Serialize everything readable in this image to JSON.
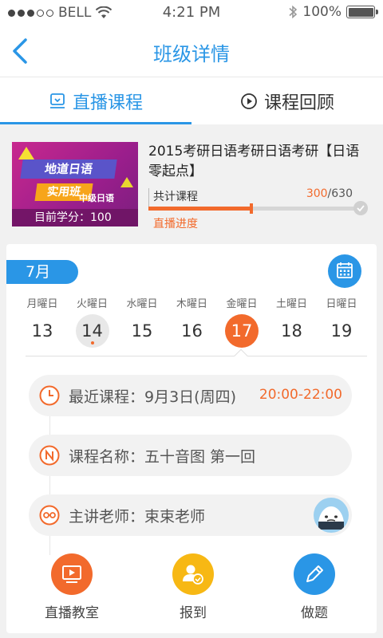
{
  "status_bar": {
    "carrier": "BELL",
    "time": "4:21 PM",
    "battery": "100%"
  },
  "nav": {
    "title": "班级详情"
  },
  "tabs": [
    {
      "label": "直播课程",
      "active": true,
      "icon": "live-course-icon"
    },
    {
      "label": "课程回顾",
      "active": false,
      "icon": "play-review-icon"
    }
  ],
  "course": {
    "thumbnail": {
      "line1": "地道日语",
      "line2": "实用班",
      "line3": "中级日语",
      "credit": "目前学分：100"
    },
    "title": "2015考研日语考研日语考研【日语零起点】",
    "total_label": "共计课程",
    "progress_current": "300",
    "progress_total": "/630",
    "progress_fraction": 0.476,
    "live_progress_label": "直播进度"
  },
  "calendar": {
    "month": "7月",
    "days": [
      {
        "weekday": "月曜日",
        "date": "13"
      },
      {
        "weekday": "火曜日",
        "date": "14",
        "today": true
      },
      {
        "weekday": "水曜日",
        "date": "15"
      },
      {
        "weekday": "木曜日",
        "date": "16"
      },
      {
        "weekday": "金曜日",
        "date": "17",
        "selected": true
      },
      {
        "weekday": "土曜日",
        "date": "18"
      },
      {
        "weekday": "日曜日",
        "date": "19"
      }
    ]
  },
  "details": {
    "recent": "最近课程：9月3日(周四)",
    "recent_time": "20:00-22:00",
    "name": "课程名称：五十音图 第一回",
    "teacher": "主讲老师：束束老师"
  },
  "actions": [
    {
      "label": "直播教室",
      "icon": "live-classroom-icon"
    },
    {
      "label": "报到",
      "icon": "check-in-icon"
    },
    {
      "label": "做题",
      "icon": "pencil-icon"
    }
  ],
  "colors": {
    "accent": "#2a96e6",
    "orange": "#f26a2c",
    "yellow": "#f7b814"
  }
}
